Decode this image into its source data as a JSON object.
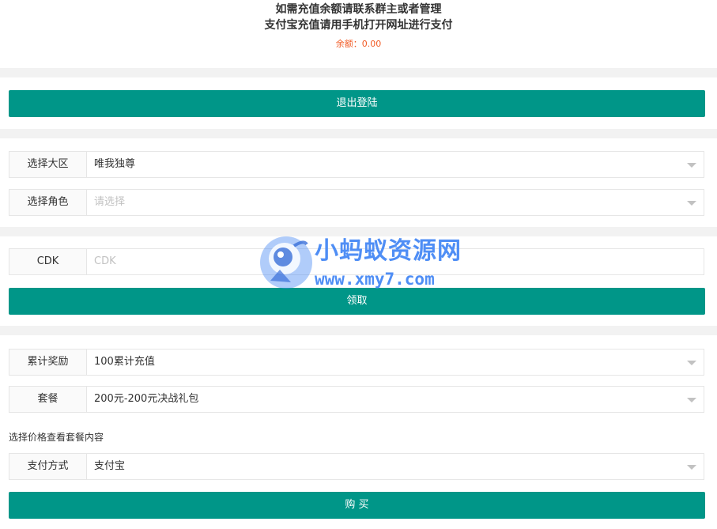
{
  "header": {
    "line1": "如需充值余额请联系群主或者管理",
    "line2": "支付宝充值请用手机打开网址进行支付",
    "balance_label": "余额：",
    "balance_value": "0.00"
  },
  "logout_button": "退出登陆",
  "server_select": {
    "label": "选择大区",
    "value": "唯我独尊"
  },
  "role_select": {
    "label": "选择角色",
    "placeholder": "请选择"
  },
  "cdk": {
    "label": "CDK",
    "placeholder": "CDK",
    "button": "领取"
  },
  "reward_select": {
    "label": "累计奖励",
    "value": "100累计充值"
  },
  "package_select": {
    "label": "套餐",
    "value": "200元-200元决战礼包"
  },
  "package_hint": "选择价格查看套餐内容",
  "payment_select": {
    "label": "支付方式",
    "value": "支付宝"
  },
  "buy_button": "购 买",
  "watermark": {
    "title": "小蚂蚁资源网",
    "url": "www.xmy7.com"
  },
  "colors": {
    "primary": "#009688",
    "balance": "#f15a24",
    "watermark": "#4f8ef5"
  }
}
